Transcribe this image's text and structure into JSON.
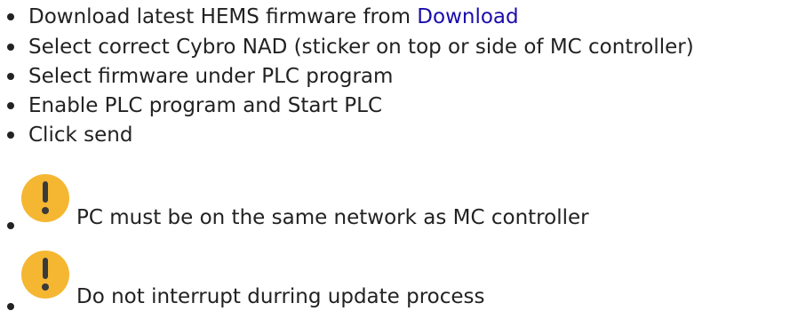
{
  "steps": {
    "step1": {
      "text": "Download latest HEMS firmware from ",
      "link": "Download"
    },
    "step2": "Select correct Cybro NAD (sticker on top or side of MC controller)",
    "step3": "Select firmware under PLC program",
    "step4": "Enable PLC program and Start PLC",
    "step5": "Click send",
    "warning1": "PC must be on the same network as MC controller",
    "warning2": "Do not interrupt durring update process"
  },
  "colors": {
    "link": "#1a0dab",
    "warning_icon": "#f5b731"
  },
  "icons": {
    "warning": "exclamation-warning-icon"
  }
}
